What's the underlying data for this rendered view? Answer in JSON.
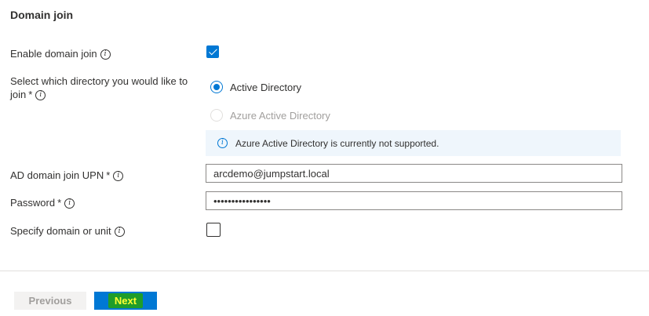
{
  "section": {
    "title": "Domain join"
  },
  "fields": {
    "enable_domain_join": {
      "label": "Enable domain join",
      "checked": true
    },
    "directory": {
      "label": "Select which directory you would like to join",
      "required_mark": "*",
      "options": [
        {
          "label": "Active Directory",
          "selected": true,
          "disabled": false
        },
        {
          "label": "Azure Active Directory",
          "selected": false,
          "disabled": true
        }
      ],
      "info_message": "Azure Active Directory is currently not supported."
    },
    "upn": {
      "label": "AD domain join UPN",
      "required_mark": "*",
      "value": "arcdemo@jumpstart.local"
    },
    "password": {
      "label": "Password",
      "required_mark": "*",
      "value": "••••••••••••••••"
    },
    "specify_domain_or_unit": {
      "label": "Specify domain or unit",
      "checked": false
    }
  },
  "footer": {
    "previous_label": "Previous",
    "next_label": "Next"
  },
  "icons": {
    "info": "info-icon",
    "check": "checkmark-icon"
  },
  "colors": {
    "accent": "#0078d4",
    "highlight_bg": "#1f9d2a",
    "highlight_text": "#ffff33",
    "info_bg": "#eff6fc"
  }
}
